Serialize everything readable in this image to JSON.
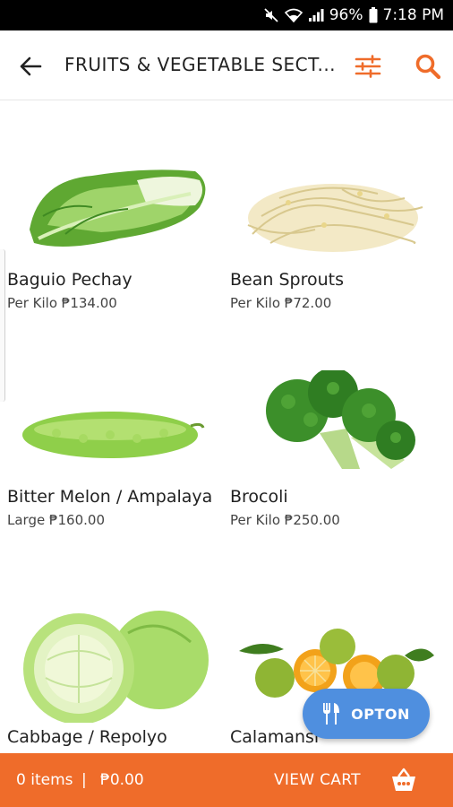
{
  "status_bar": {
    "battery": "96%",
    "time": "7:18 PM",
    "icons": [
      "mute-icon",
      "wifi-icon",
      "signal-icon",
      "battery-icon"
    ]
  },
  "app_bar": {
    "title": "FRUITS & VEGETABLE SECT...",
    "back_icon": "back-arrow-icon",
    "filter_icon": "filter-sliders-icon",
    "search_icon": "search-icon",
    "accent_color": "#ef6c2a"
  },
  "products": [
    {
      "name": "Baguio Pechay",
      "price": "Per Kilo ₱134.00",
      "image": "pechay-image"
    },
    {
      "name": "Bean Sprouts",
      "price": "Per Kilo ₱72.00",
      "image": "bean-sprouts-image"
    },
    {
      "name": "Bitter Melon / Ampalaya",
      "price": "Large ₱160.00",
      "image": "bitter-melon-image"
    },
    {
      "name": "Brocoli",
      "price": "Per Kilo ₱250.00",
      "image": "broccoli-image"
    },
    {
      "name": "Cabbage / Repolyo",
      "price": "",
      "image": "cabbage-image"
    },
    {
      "name": "Calamansi",
      "price": "",
      "image": "calamansi-image"
    }
  ],
  "fab": {
    "label": "OPTON",
    "icon": "fork-knife-icon",
    "color": "#4f8fdf"
  },
  "bottom_bar": {
    "items": "0 items",
    "separator": "|",
    "total": "₱0.00",
    "view_cart": "VIEW CART",
    "basket_icon": "basket-icon",
    "color": "#ef6c2a"
  }
}
